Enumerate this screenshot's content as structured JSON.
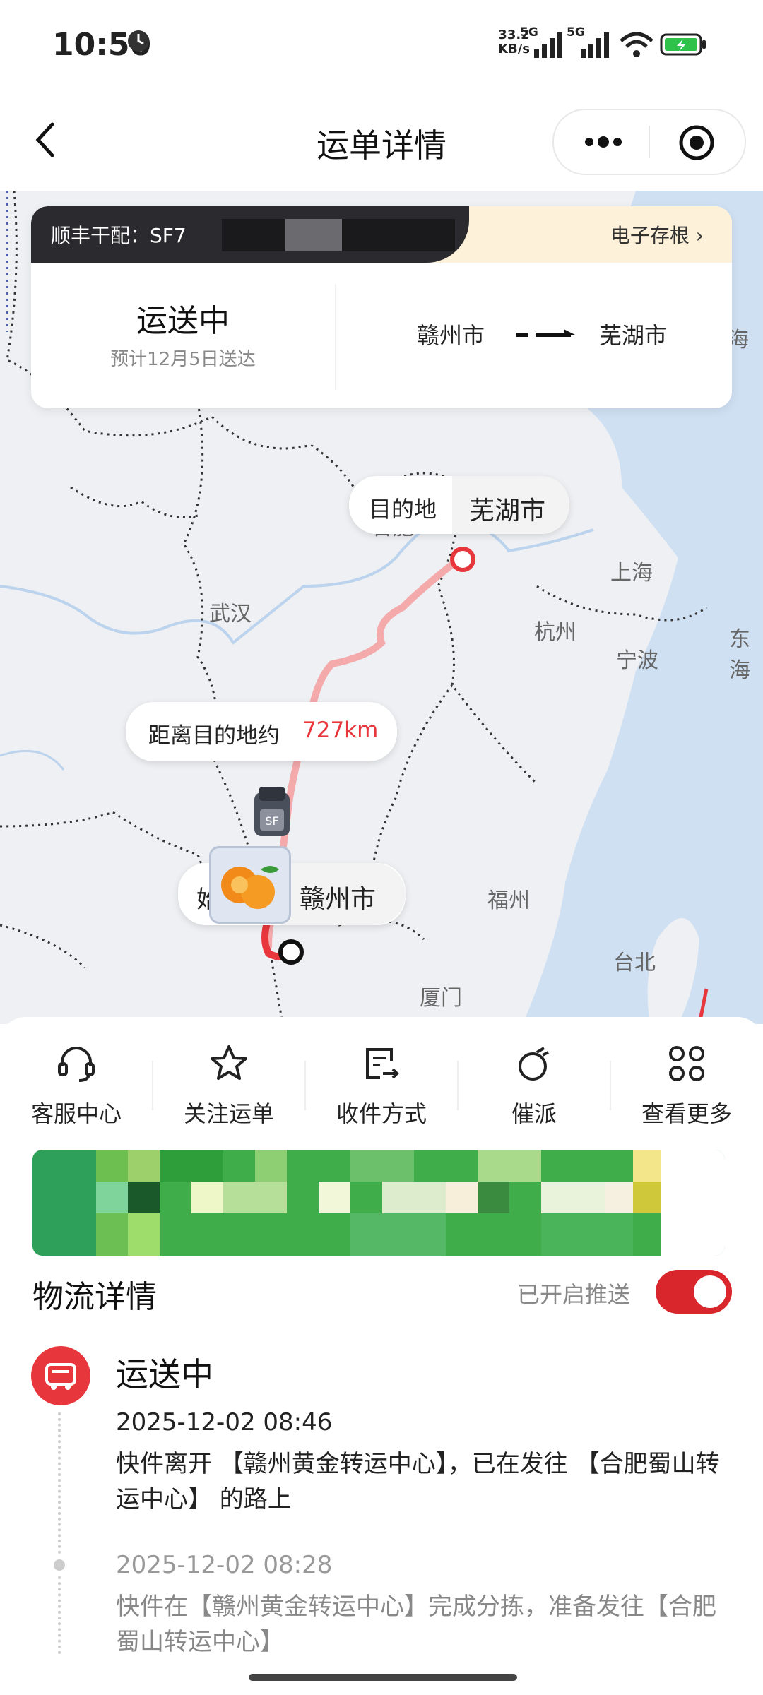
{
  "status_bar": {
    "time": "10:50",
    "net_speed": "33.2",
    "net_unit": "KB/s",
    "sim1": "5G",
    "sim2": "5G"
  },
  "header": {
    "title": "运单详情"
  },
  "waybill": {
    "label": "顺丰干配：SF7",
    "stub_link": "电子存根 ›",
    "status": "运送中",
    "eta": "预计12月5日送达",
    "from": "赣州市",
    "to": "芜湖市"
  },
  "map": {
    "labels": [
      "海",
      "上海",
      "杭州",
      "宁波",
      "东海",
      "武汉",
      "合肥",
      "福州",
      "台北",
      "厦门"
    ],
    "dest_bubble": {
      "label": "目的地",
      "city": "芜湖市"
    },
    "distance_bubble": {
      "prefix": "距离目的地约",
      "distance": "727km"
    },
    "origin_bubble": {
      "label": "始",
      "city": "赣州市"
    },
    "colors": {
      "route": "#f4a9ab",
      "route_done": "#e8363d",
      "accent": "#d9262c"
    }
  },
  "actions": [
    {
      "label": "客服中心",
      "icon": "headset-icon"
    },
    {
      "label": "关注运单",
      "icon": "star-icon"
    },
    {
      "label": "收件方式",
      "icon": "receive-method-icon"
    },
    {
      "label": "催派",
      "icon": "stopwatch-icon"
    },
    {
      "label": "查看更多",
      "icon": "grid-more-icon"
    }
  ],
  "logistics": {
    "title": "物流详情",
    "push_label": "已开启推送",
    "push_enabled": true,
    "current_status": "运送中",
    "events": [
      {
        "time": "2025-12-02 08:46",
        "desc": "快件离开 【赣州黄金转运中心】，已在发往 【合肥蜀山转运中心】 的路上"
      },
      {
        "time": "2025-12-02 08:28",
        "desc": "快件在【赣州黄金转运中心】完成分拣，准备发往【合肥蜀山转运中心】"
      }
    ]
  }
}
